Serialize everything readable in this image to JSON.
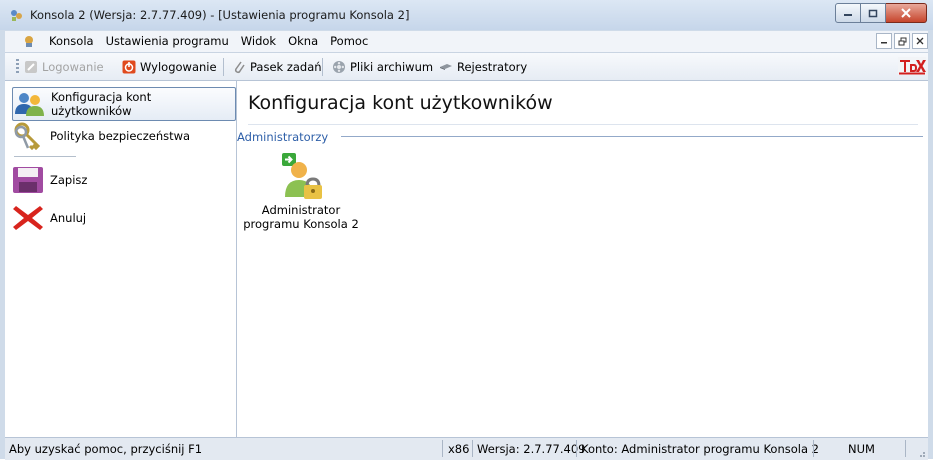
{
  "window": {
    "title": "Konsola 2 (Wersja:  2.7.77.409) - [Ustawienia programu Konsola 2]"
  },
  "menu": {
    "items": [
      "Konsola",
      "Ustawienia programu",
      "Widok",
      "Okna",
      "Pomoc"
    ]
  },
  "toolbar": {
    "login": "Logowanie",
    "logout": "Wylogowanie",
    "taskbar": "Pasek zadań",
    "archive": "Pliki archiwum",
    "recorders": "Rejestratory"
  },
  "sidebar": {
    "items": [
      {
        "label": "Konfiguracja kont użytkowników",
        "icon": "users-icon",
        "selected": true
      },
      {
        "label": "Polityka bezpieczeństwa",
        "icon": "keys-icon",
        "selected": false
      }
    ],
    "actions": [
      {
        "label": "Zapisz",
        "icon": "save-icon"
      },
      {
        "label": "Anuluj",
        "icon": "cancel-icon"
      }
    ]
  },
  "main": {
    "title": "Konfiguracja kont użytkowników",
    "group_label": "Administratorzy",
    "admin_label_line1": "Administrator",
    "admin_label_line2": "programu Konsola 2"
  },
  "status": {
    "help": "Aby uzyskać pomoc, przyciśnij F1",
    "arch": "x86",
    "version": "Wersja: 2.7.77.409",
    "account": "Konto: Administrator programu Konsola 2",
    "num": "NUM"
  },
  "colors": {
    "group_label": "#2e5fa8",
    "close_button": "#c6452c",
    "selected_border": "#6d8bb1"
  }
}
